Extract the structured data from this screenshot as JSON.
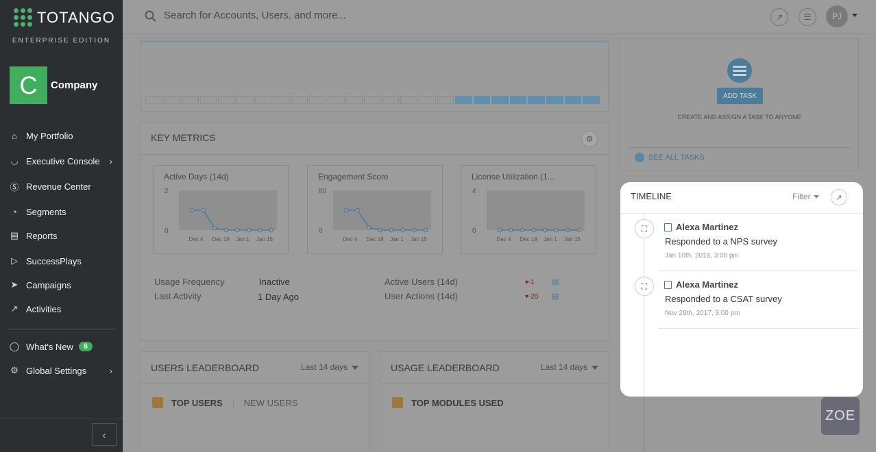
{
  "brand": {
    "name": "TOTANGO",
    "edition": "ENTERPRISE EDITION"
  },
  "company": {
    "initial": "C",
    "name": "Company"
  },
  "sidebar": {
    "items": [
      {
        "label": "My Portfolio",
        "icon": "home-icon"
      },
      {
        "label": "Executive Console",
        "icon": "gauge-icon"
      },
      {
        "label": "Revenue Center",
        "icon": "dollar-icon"
      },
      {
        "label": "Segments",
        "icon": "pie-icon"
      },
      {
        "label": "Reports",
        "icon": "bar-chart-icon"
      },
      {
        "label": "SuccessPlays",
        "icon": "play-icon"
      },
      {
        "label": "Campaigns",
        "icon": "megaphone-icon"
      },
      {
        "label": "Activities",
        "icon": "line-chart-icon"
      }
    ],
    "whats_new": {
      "label": "What's New",
      "count": "6"
    },
    "global_settings": {
      "label": "Global Settings"
    }
  },
  "search": {
    "placeholder": "Search for Accounts, Users, and more..."
  },
  "user": {
    "initials": "PJ"
  },
  "key_metrics": {
    "title": "KEY METRICS",
    "charts": [
      {
        "title": "Active Days (14d)",
        "y_top": "2",
        "y_bottom": "0"
      },
      {
        "title": "Engagement Score",
        "y_top": "80",
        "y_bottom": "0"
      },
      {
        "title": "License Utilization (1...",
        "y_top": "4",
        "y_bottom": "0"
      }
    ],
    "x_ticks": [
      "Dec 4",
      "Dec 18",
      "Jan 1",
      "Jan 15"
    ],
    "rows": {
      "usage_frequency_label": "Usage Frequency",
      "usage_frequency_value": "Inactive",
      "last_activity_label": "Last Activity",
      "last_activity_value": "1 Day Ago",
      "active_users_label": "Active Users (14d)",
      "active_users_delta": "-1",
      "user_actions_label": "User Actions (14d)",
      "user_actions_delta": "-20"
    }
  },
  "chart_data": [
    {
      "type": "line",
      "title": "Active Days (14d)",
      "x": [
        1,
        2,
        3,
        4,
        5,
        6,
        7,
        8
      ],
      "values": [
        1,
        1,
        0.1,
        0,
        0,
        0,
        0,
        0
      ],
      "ylim": [
        0,
        2
      ]
    },
    {
      "type": "line",
      "title": "Engagement Score",
      "x": [
        1,
        2,
        3,
        4,
        5,
        6,
        7,
        8
      ],
      "values": [
        40,
        40,
        5,
        0,
        0,
        0,
        0,
        0
      ],
      "ylim": [
        0,
        80
      ]
    },
    {
      "type": "line",
      "title": "License Utilization",
      "x": [
        1,
        2,
        3,
        4,
        5,
        6,
        7,
        8
      ],
      "values": [
        0,
        0,
        0,
        0,
        0,
        0,
        0,
        0
      ],
      "ylim": [
        0,
        4
      ]
    }
  ],
  "users_leaderboard": {
    "title": "USERS LEADERBOARD",
    "range": "Last 14 days",
    "tab_active": "TOP USERS",
    "tab_other": "NEW USERS"
  },
  "usage_leaderboard": {
    "title": "USAGE LEADERBOARD",
    "range": "Last 14 days",
    "tab_active": "TOP MODULES USED"
  },
  "tasks": {
    "add_label": "ADD TASK",
    "subtitle": "CREATE AND ASSIGN A TASK TO ANYONE",
    "see_all": "SEE ALL TASKS"
  },
  "timeline": {
    "title": "TIMELINE",
    "filter": "Filter",
    "events": [
      {
        "name": "Alexa Martinez",
        "action": "Responded to a NPS survey",
        "date": "Jan 10th, 2018, 3:00 pm"
      },
      {
        "name": "Alexa Martinez",
        "action": "Responded to a CSAT survey",
        "date": "Nov 29th, 2017, 3:00 pm"
      }
    ]
  },
  "assistant": {
    "label": "ZOE"
  }
}
